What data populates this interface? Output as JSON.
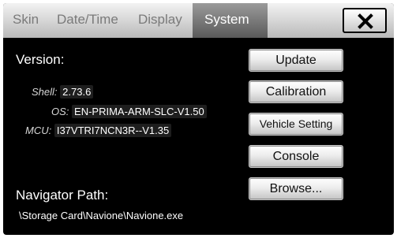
{
  "tabs": [
    {
      "label": "Skin"
    },
    {
      "label": "Date/Time"
    },
    {
      "label": "Display"
    },
    {
      "label": "System"
    }
  ],
  "close_icon": "close-x-icon",
  "version": {
    "heading": "Version:",
    "shell_key": "Shell:",
    "shell_value": "2.73.6",
    "os_key": "OS:",
    "os_value": "EN-PRIMA-ARM-SLC-V1.50",
    "mcu_key": "MCU:",
    "mcu_value": "I37VTRI7NCN3R--V1.35"
  },
  "navigator": {
    "heading": "Navigator Path:",
    "path": "\\Storage Card\\Navione\\Navione.exe"
  },
  "buttons": {
    "update": "Update",
    "calibration": "Calibration",
    "vehicle_setting": "Vehicle Setting",
    "console": "Console",
    "browse": "Browse..."
  },
  "colors": {
    "background": "#000000",
    "tab_active": "#ffffff",
    "tab_inactive": "#7a7a7a"
  }
}
